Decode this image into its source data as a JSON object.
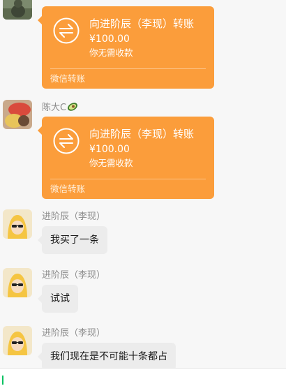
{
  "messages": [
    {
      "type": "transfer",
      "transfer": {
        "title": "向进阶辰（李现）转账",
        "amount": "¥100.00",
        "status": "你无需收款",
        "footer": "微信转账"
      }
    },
    {
      "type": "transfer",
      "sender": "陈大C",
      "sender_emoji": "avocado-icon",
      "transfer": {
        "title": "向进阶辰（李现）转账",
        "amount": "¥100.00",
        "status": "你无需收款",
        "footer": "微信转账"
      }
    },
    {
      "type": "text",
      "sender": "进阶辰（李现）",
      "text": "我买了一条"
    },
    {
      "type": "text",
      "sender": "进阶辰（李现）",
      "text": "试试"
    },
    {
      "type": "text",
      "sender": "进阶辰（李现）",
      "text": "我们现在是不可能十条都占"
    }
  ],
  "colors": {
    "transfer_card": "#fb9d3b",
    "text_bubble": "#ececec",
    "caret": "#07c160"
  }
}
